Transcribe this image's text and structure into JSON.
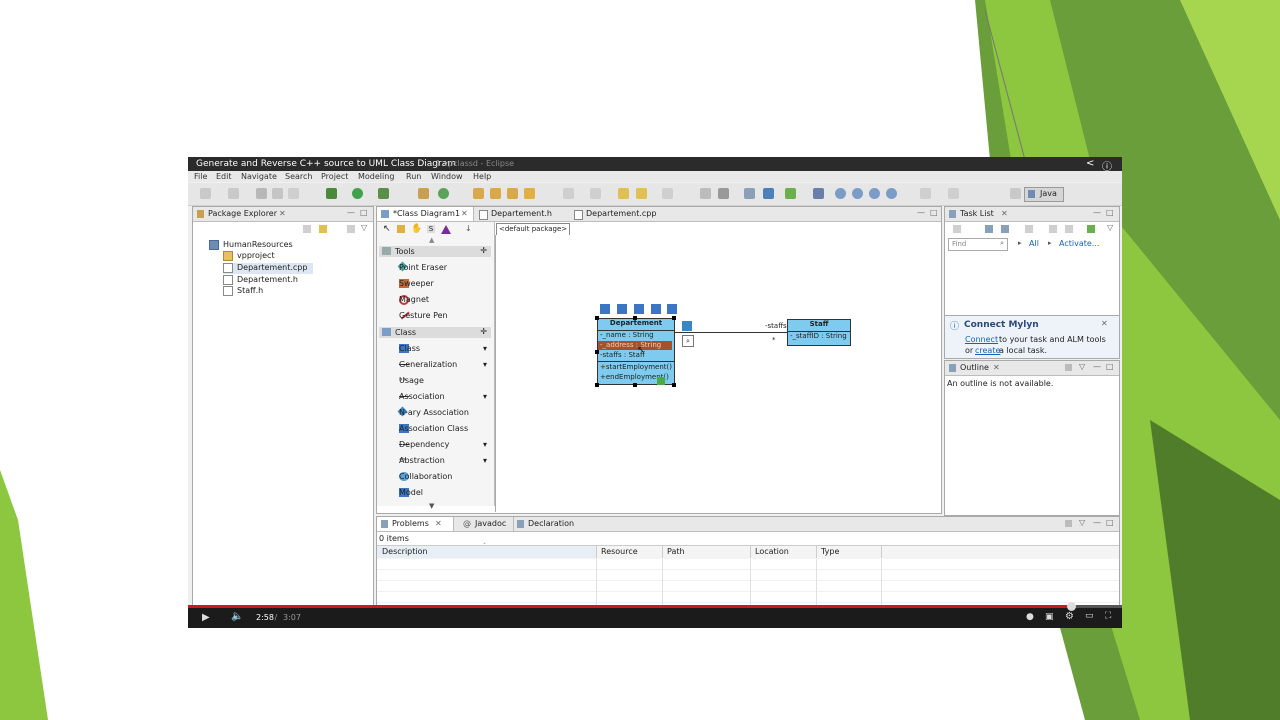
{
  "video": {
    "title": "Generate and Reverse C++ source to UML Class Diagram",
    "title_overlay": "...1.vpclassd - Eclipse",
    "time_current": "2:58",
    "time_sep": " / ",
    "time_total": "3:07",
    "progress": 0.945
  },
  "menu": [
    "File",
    "Edit",
    "Navigate",
    "Search",
    "Project",
    "Modeling",
    "Run",
    "Window",
    "Help"
  ],
  "perspective": {
    "label": "Java"
  },
  "package_explorer": {
    "tab_label": "Package Explorer",
    "project": "HumanResources",
    "items": [
      "vpproject",
      "Departement.cpp",
      "Departement.h",
      "Staff.h"
    ]
  },
  "editor": {
    "tabs": [
      "*Class Diagram1",
      "Departement.h",
      "Departement.cpp"
    ],
    "breadcrumb": "<default package>"
  },
  "palette": {
    "tools_header": "Tools",
    "tools": [
      "Point Eraser",
      "Sweeper",
      "Magnet",
      "Gesture Pen"
    ],
    "class_header": "Class",
    "class_items": [
      "Class",
      "Generalization",
      "Usage",
      "Association",
      "N-ary Association",
      "Association Class",
      "Dependency",
      "Abstraction",
      "Collaboration",
      "Model"
    ]
  },
  "diagram": {
    "departement": {
      "name": "Departement",
      "attributes": [
        "-_name : String",
        "-_address : String",
        "-staffs : Staff"
      ],
      "operations": [
        "+startEmployment()",
        "+endEmployment()"
      ]
    },
    "staff": {
      "name": "Staff",
      "attributes": [
        "-_staffID : String"
      ]
    },
    "association": {
      "role": "-staffs",
      "multiplicity": "*"
    }
  },
  "task_list": {
    "tab_label": "Task List",
    "find_placeholder": "Find",
    "filter_all": "All",
    "filter_activate": "Activate..."
  },
  "mylyn": {
    "title": "Connect Mylyn",
    "link_connect": "Connect",
    "line1_rest": " to your task and ALM tools",
    "line2_pre": "or ",
    "link_create": "create",
    "line2_rest": " a local task."
  },
  "outline": {
    "tab_label": "Outline",
    "message": "An outline is not available."
  },
  "problems": {
    "tabs": [
      "Problems",
      "Javadoc",
      "Declaration"
    ],
    "count": "0 items",
    "columns": [
      "Description",
      "Resource",
      "Path",
      "Location",
      "Type"
    ]
  },
  "colors": {
    "accent_green": "#8dc63f",
    "uml_class_fill": "#7ecbef",
    "selected_attribute": "#a4522b",
    "progress_red": "#cc181e"
  }
}
